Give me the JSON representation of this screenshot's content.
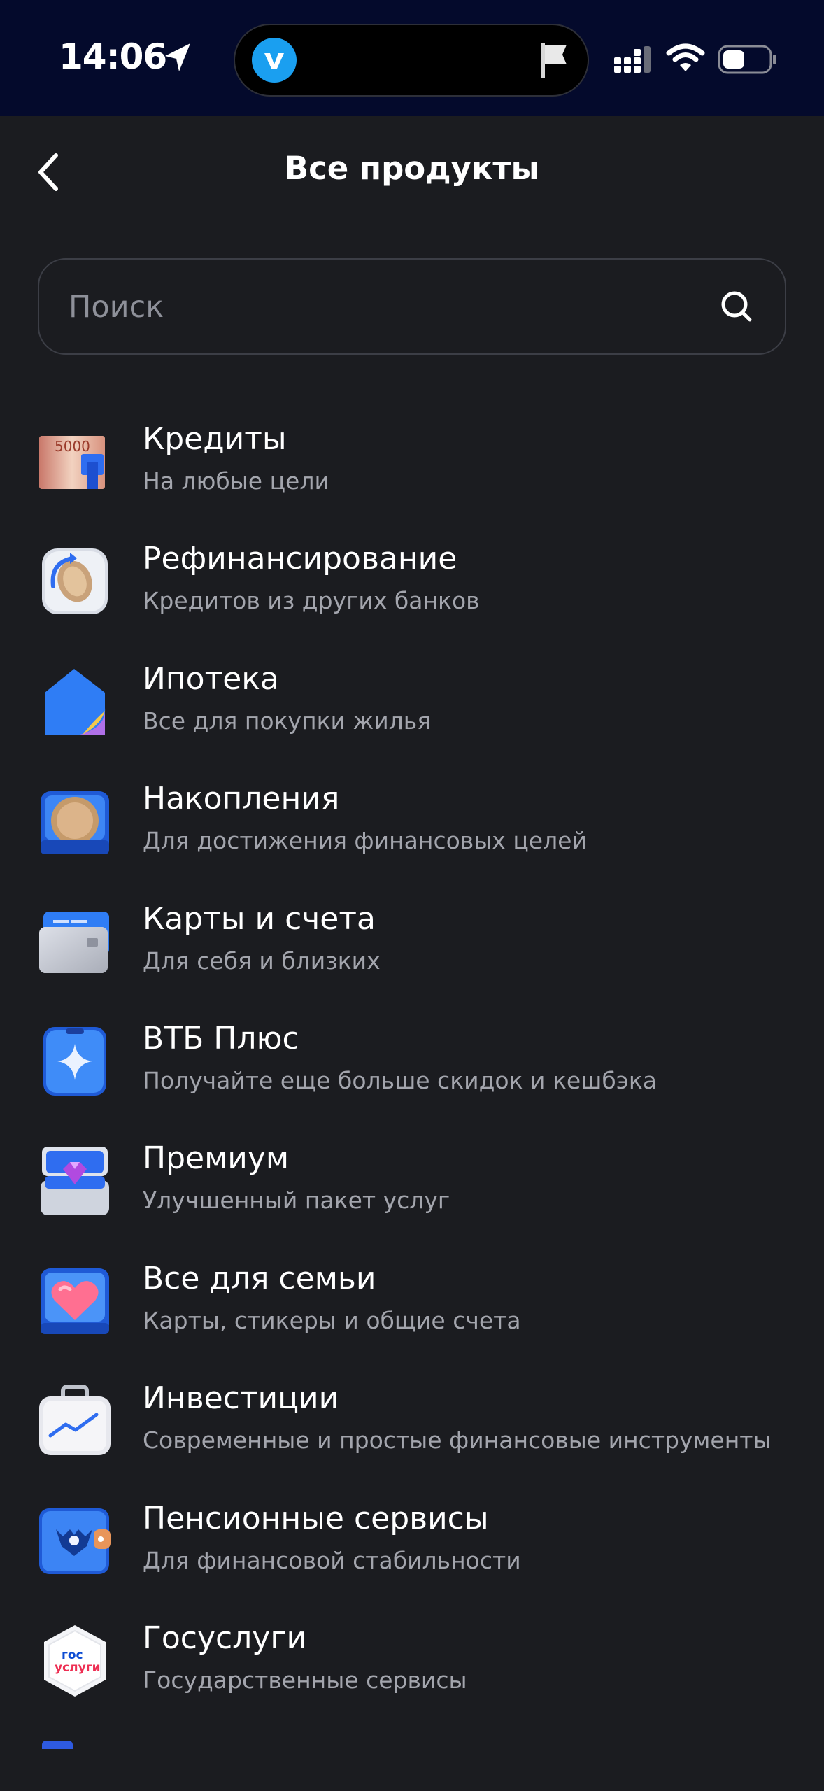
{
  "status_bar": {
    "time": "14:06",
    "island_app_icon": "vk-logo",
    "island_right_icon": "flag-icon",
    "indicators": [
      "signal-icon",
      "wifi-icon",
      "battery-icon"
    ]
  },
  "header": {
    "title": "Все продукты",
    "back_icon": "chevron-left-icon"
  },
  "search": {
    "placeholder": "Поиск",
    "value": "",
    "icon": "search-icon"
  },
  "products": [
    {
      "title": "Кредиты",
      "subtitle": "На любые цели",
      "icon": "banknotes-icon",
      "icon_label": "5000"
    },
    {
      "title": "Рефинансирование",
      "subtitle": "Кредитов из других банков",
      "icon": "refresh-coin-icon"
    },
    {
      "title": "Ипотека",
      "subtitle": "Все для покупки жилья",
      "icon": "house-icon"
    },
    {
      "title": "Накопления",
      "subtitle": "Для достижения финансовых целей",
      "icon": "coin-icon"
    },
    {
      "title": "Карты и счета",
      "subtitle": "Для себя и близких",
      "icon": "cards-icon"
    },
    {
      "title": "ВТБ Плюс",
      "subtitle": "Получайте еще больше скидок и кешбэка",
      "icon": "sparkle-icon"
    },
    {
      "title": "Премиум",
      "subtitle": "Улучшенный пакет услуг",
      "icon": "diamond-box-icon"
    },
    {
      "title": "Все для семьи",
      "subtitle": "Карты, стикеры и общие счета",
      "icon": "heart-icon"
    },
    {
      "title": "Инвестиции",
      "subtitle": "Современные и простые финансовые инструменты",
      "icon": "briefcase-chart-icon"
    },
    {
      "title": "Пенсионные сервисы",
      "subtitle": "Для финансовой стабильности",
      "icon": "wallet-emblem-icon"
    },
    {
      "title": "Госуслуги",
      "subtitle": "Государственные сервисы",
      "icon": "gosuslugi-icon",
      "icon_label_top": "гос",
      "icon_label_bottom": "услуги"
    }
  ],
  "colors": {
    "background": "#1b1c20",
    "status_bar": "#040a2c",
    "text_primary": "#ffffff",
    "text_secondary": "#a3a5ad",
    "accent_blue": "#2f6df0"
  }
}
